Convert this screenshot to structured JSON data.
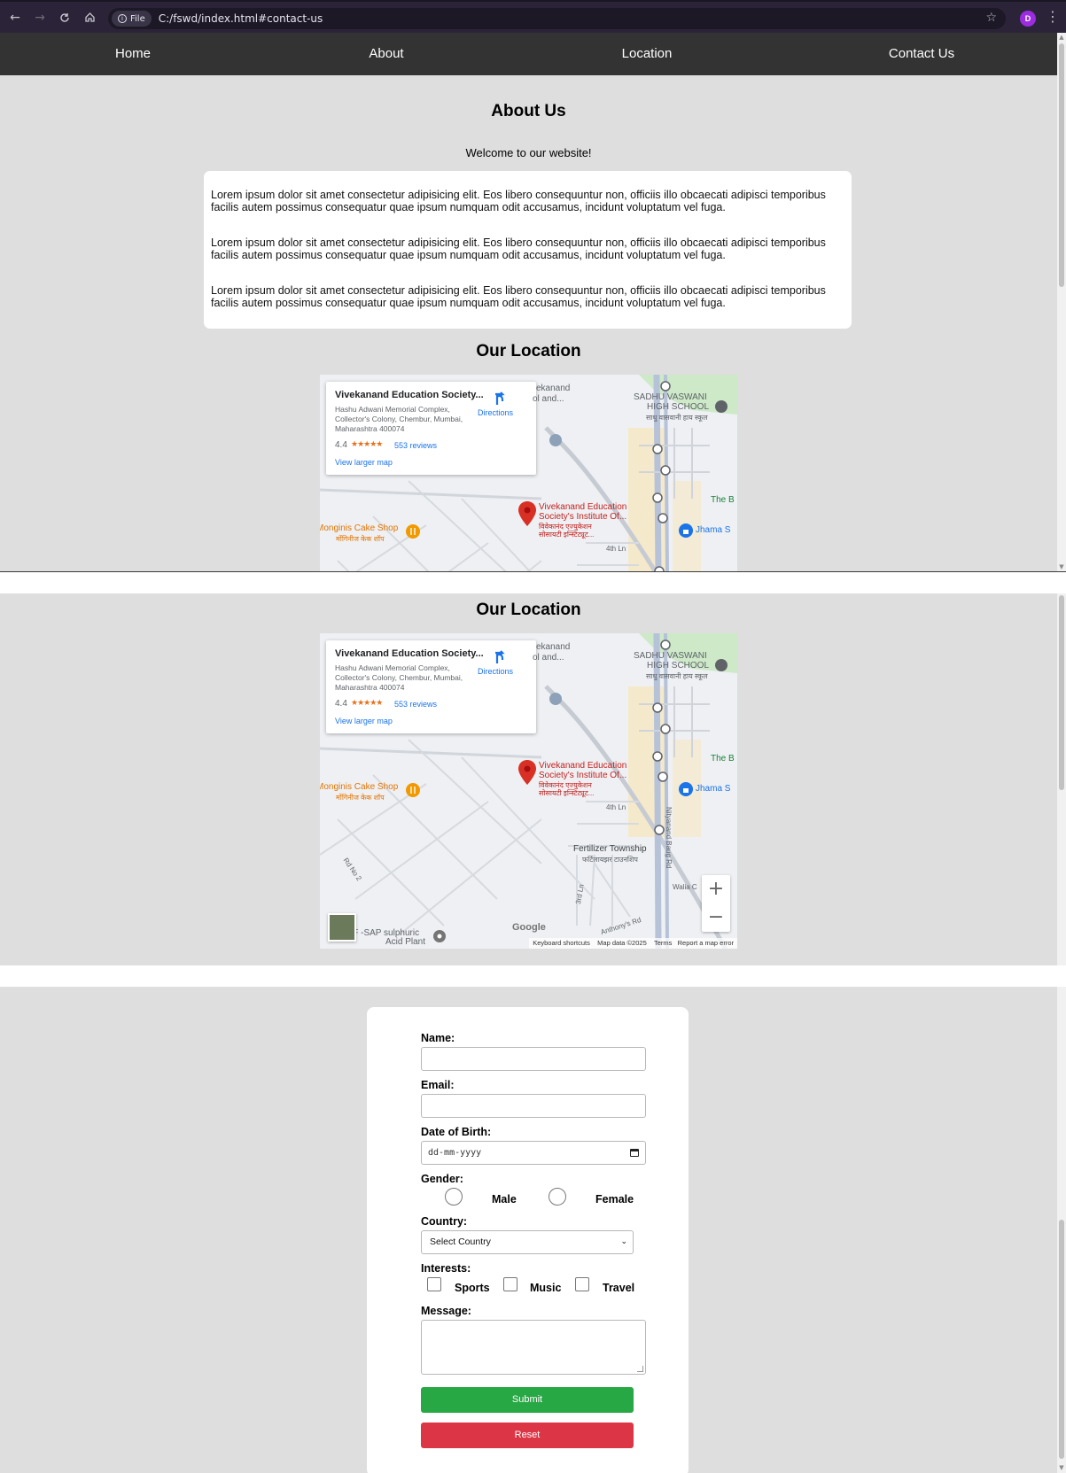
{
  "browser": {
    "address": "C:/fswd/index.html#contact-us",
    "file_chip": "File",
    "profile_initial": "D",
    "icons": [
      "back-arrow-icon",
      "forward-arrow-icon",
      "reload-icon",
      "home-icon",
      "info-icon",
      "star-icon",
      "kebab-menu-icon"
    ]
  },
  "nav": {
    "items": [
      "Home",
      "About",
      "Location",
      "Contact Us"
    ]
  },
  "about": {
    "title": "About Us",
    "welcome": "Welcome to our website!",
    "paragraphs": [
      "Lorem ipsum dolor sit amet consectetur adipisicing elit. Eos libero consequuntur non, officiis illo obcaecati adipisci temporibus facilis autem possimus consequatur quae ipsum numquam odit accusamus, incidunt voluptatum vel fuga.",
      "Lorem ipsum dolor sit amet consectetur adipisicing elit. Eos libero consequuntur non, officiis illo obcaecati adipisci temporibus facilis autem possimus consequatur quae ipsum numquam odit accusamus, incidunt voluptatum vel fuga.",
      "Lorem ipsum dolor sit amet consectetur adipisicing elit. Eos libero consequuntur non, officiis illo obcaecati adipisci temporibus facilis autem possimus consequatur quae ipsum numquam odit accusamus, incidunt voluptatum vel fuga."
    ]
  },
  "location": {
    "title": "Our Location",
    "map": {
      "place_name": "Vivekanand Education Society...",
      "address": "Hashu Adwani Memorial Complex, Collector's Colony, Chembur, Mumbai, Maharashtra 400074",
      "rating": "4.4",
      "stars": "★★★★★",
      "reviews": "553 reviews",
      "larger_map": "View larger map",
      "directions": "Directions",
      "labels": {
        "ekanand": "ekanand",
        "ol_and": "ol and...",
        "sadhu1": "SADHU VASWANI",
        "sadhu2": "HIGH SCHOOL",
        "sadhu_hi": "साधु वासवानी हाय स्कूल",
        "ves1": "Vivekanand Education",
        "ves2": "Society's Institute Of...",
        "ves_hi1": "विवेकानंद एज्युकेशन",
        "ves_hi2": "सोसायटी इन्स्टिट्यूट...",
        "monginis": "Monginis Cake Shop",
        "monginis_hi": "मोंगिनीज केक शॉप",
        "jhama": "Jhama S",
        "the_b": "The B",
        "fourth_ln": "4th Ln",
        "fertilizer": "Fertilizer Township",
        "fertilizer_hi": "फर्टिलायझर टाउनशिप",
        "rd_no2": "Rd No 2",
        "third_ln": "3rd Ln",
        "walia": "Walia C",
        "nityanand": "Nityanand Baug Rd",
        "sap1": "CF -SAP sulphuric",
        "sap2": "Acid Plant",
        "anthonys": "Anthony's Rd"
      },
      "google": "Google",
      "attribution": [
        "Keyboard shortcuts",
        "Map data ©2025",
        "Terms",
        "Report a map error"
      ],
      "zoom_in": "+",
      "zoom_out": "−"
    }
  },
  "form": {
    "name_label": "Name:",
    "email_label": "Email:",
    "dob_label": "Date of Birth:",
    "dob_placeholder": "dd-mm-yyyy",
    "gender_label": "Gender:",
    "gender_options": [
      "Male",
      "Female"
    ],
    "country_label": "Country:",
    "country_selected": "Select Country",
    "interests_label": "Interests:",
    "interests": [
      "Sports",
      "Music",
      "Travel"
    ],
    "message_label": "Message:",
    "submit": "Submit",
    "reset": "Reset",
    "colors": {
      "submit": "#28a745",
      "reset": "#dc3545"
    }
  }
}
